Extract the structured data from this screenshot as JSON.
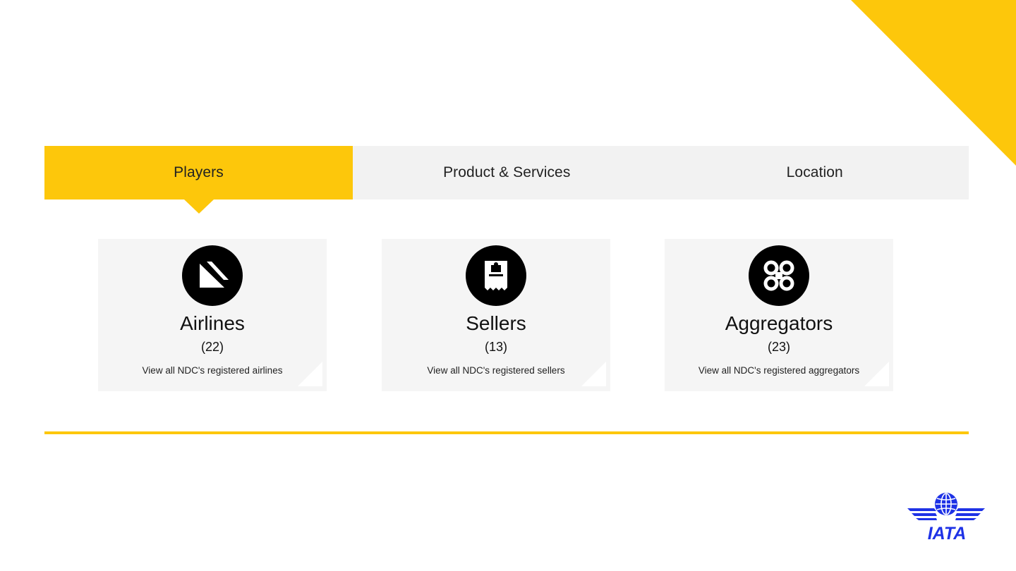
{
  "tabs": [
    {
      "label": "Players",
      "active": true
    },
    {
      "label": "Product & Services",
      "active": false
    },
    {
      "label": "Location",
      "active": false
    }
  ],
  "cards": [
    {
      "title": "Airlines",
      "count": "(22)",
      "description": "View all NDC's registered airlines",
      "icon": "airline-tail-icon"
    },
    {
      "title": "Sellers",
      "count": "(13)",
      "description": "View all NDC's registered sellers",
      "icon": "ticket-icon"
    },
    {
      "title": "Aggregators",
      "count": "(23)",
      "description": "View all NDC's registered aggregators",
      "icon": "network-nodes-icon"
    }
  ],
  "logo": {
    "text": "IATA",
    "icon": "iata-globe-logo"
  },
  "colors": {
    "accent": "#fdc70b",
    "tab_bg": "#f2f2f2",
    "card_bg": "#f5f5f5",
    "logo_blue": "#1e32e6"
  }
}
